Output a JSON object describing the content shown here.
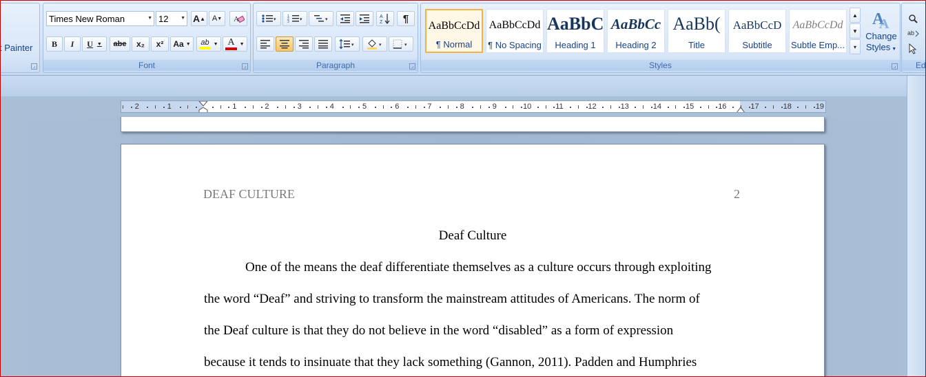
{
  "clipboard": {
    "format_painter": "t Painter",
    "launcher": "⊡"
  },
  "font": {
    "group_label": "Font",
    "name": "Times New Roman",
    "size": "12",
    "buttons": {
      "grow": "A",
      "shrink": "A",
      "clear": "A",
      "bold": "B",
      "italic": "I",
      "underline": "U",
      "strike": "abe",
      "subscript": "x₂",
      "superscript": "x²",
      "change_case": "Aa",
      "highlight": "ab",
      "font_color": "A"
    }
  },
  "paragraph": {
    "group_label": "Paragraph",
    "show_marks": "¶"
  },
  "styles": {
    "group_label": "Styles",
    "tiles": [
      {
        "sample": "AaBbCcDd",
        "name": "¶ Normal"
      },
      {
        "sample": "AaBbCcDd",
        "name": "¶ No Spacing"
      },
      {
        "sample": "AaBbC",
        "name": "Heading 1"
      },
      {
        "sample": "AaBbCc",
        "name": "Heading 2"
      },
      {
        "sample": "AaBb(",
        "name": "Title"
      },
      {
        "sample": "AaBbCcD",
        "name": "Subtitle"
      },
      {
        "sample": "AaBbCcDd",
        "name": "Subtle Emp..."
      }
    ],
    "change_styles_line1": "Change",
    "change_styles_line2": "Styles"
  },
  "editing": {
    "label": "Ed"
  },
  "ruler": {
    "left_numbers": [
      "2",
      "1"
    ],
    "right_numbers": [
      "1",
      "2",
      "3",
      "4",
      "5",
      "6",
      "7",
      "8",
      "9",
      "10",
      "11",
      "12",
      "13",
      "14",
      "15",
      "16",
      "17",
      "18",
      "19"
    ]
  },
  "document": {
    "header_left": "DEAF CULTURE",
    "header_right": "2",
    "title": "Deaf Culture",
    "lines": [
      "One of the means the deaf differentiate themselves as a culture occurs through exploiting",
      "the word “Deaf” and striving to transform the mainstream attitudes of Americans. The norm of",
      "the Deaf culture is that they do not believe in the word “disabled” as a form of expression",
      "because it tends to insinuate that they lack something (Gannon, 2011). Padden and Humphries"
    ]
  }
}
